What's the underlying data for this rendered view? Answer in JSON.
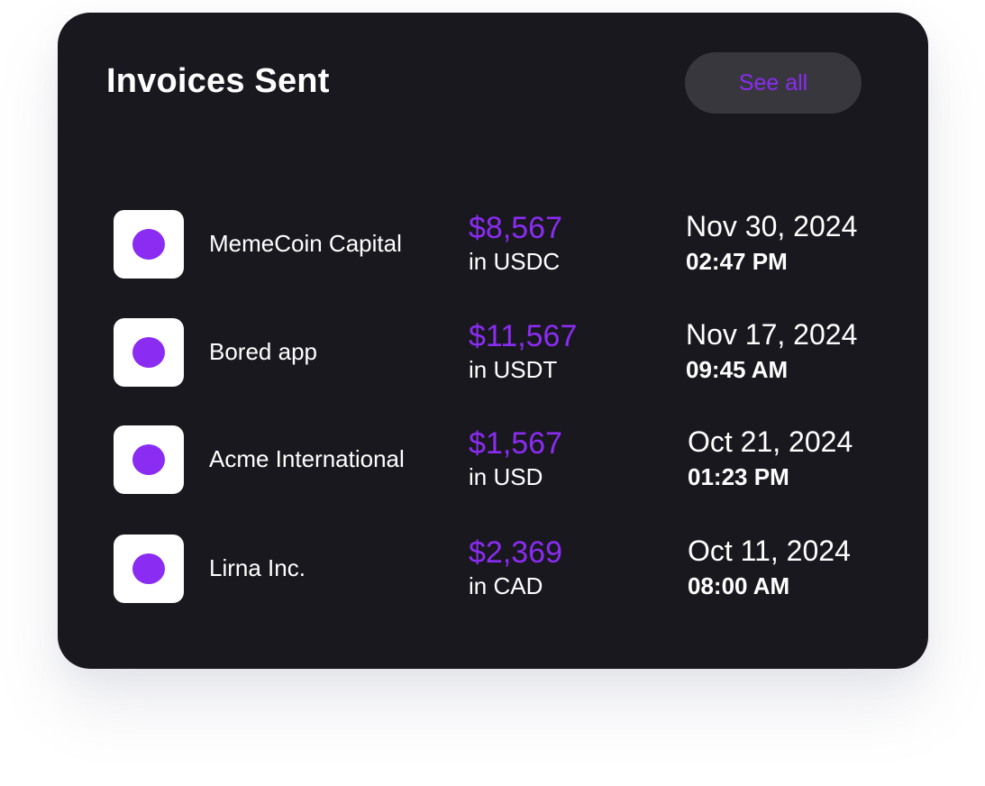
{
  "card": {
    "title": "Invoices Sent",
    "see_all_label": "See all"
  },
  "colors": {
    "background": "#19181e",
    "accent": "#8a2cf2",
    "button_bg": "#38373e",
    "text": "#ffffff"
  },
  "invoices": [
    {
      "company": "MemeCoin Capital",
      "amount": "$8,567",
      "currency": "in USDC",
      "date": "Nov 30, 2024",
      "time": "02:47 PM",
      "logo_icon": "purple-circle-logo"
    },
    {
      "company": "Bored app",
      "amount": "$11,567",
      "currency": "in USDT",
      "date": "Nov 17, 2024",
      "time": "09:45 AM",
      "logo_icon": "purple-circle-logo"
    },
    {
      "company": "Acme International",
      "amount": "$1,567",
      "currency": "in USD",
      "date": "Oct 21, 2024",
      "time": "01:23 PM",
      "logo_icon": "purple-circle-logo"
    },
    {
      "company": "Lirna Inc.",
      "amount": "$2,369",
      "currency": "in CAD",
      "date": "Oct 11, 2024",
      "time": "08:00 AM",
      "logo_icon": "purple-circle-logo"
    }
  ]
}
